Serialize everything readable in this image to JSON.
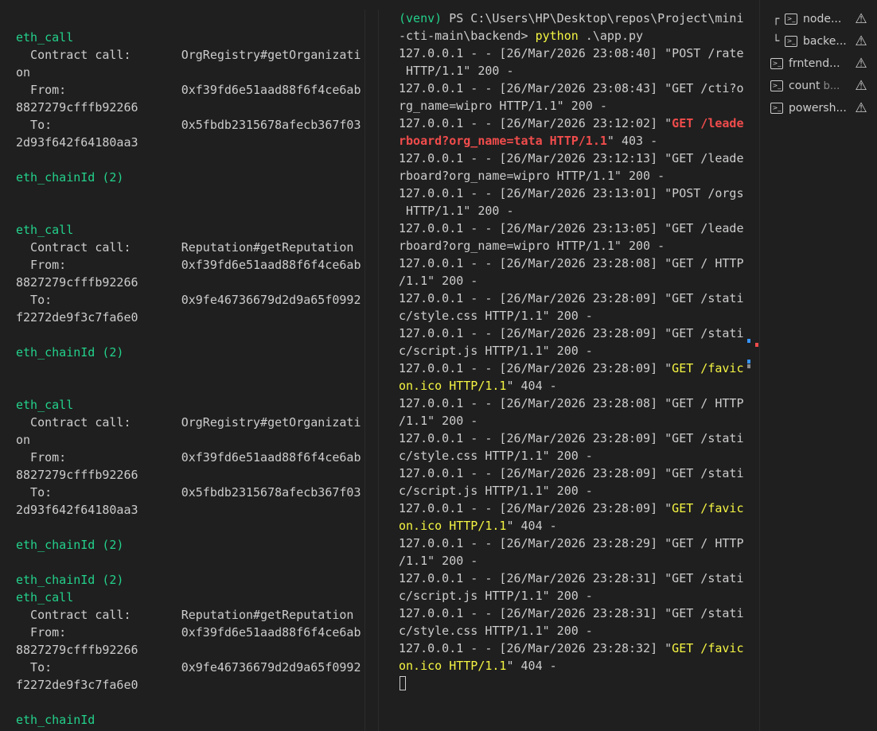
{
  "left_terminal": [
    [
      {
        "t": "eth_call",
        "c": "green"
      }
    ],
    [
      {
        "t": "  Contract call:       OrgRegistry#getOrganizati"
      }
    ],
    [
      {
        "t": "on"
      }
    ],
    [
      {
        "t": "  From:                0xf39fd6e51aad88f6f4ce6ab"
      }
    ],
    [
      {
        "t": "8827279cfffb92266"
      }
    ],
    [
      {
        "t": "  To:                  0x5fbdb2315678afecb367f03"
      }
    ],
    [
      {
        "t": "2d93f642f64180aa3"
      }
    ],
    [
      {
        "t": ""
      }
    ],
    [
      {
        "t": "eth_chainId (2)",
        "c": "green"
      }
    ],
    [
      {
        "t": ""
      }
    ],
    [
      {
        "t": ""
      }
    ],
    [
      {
        "t": "eth_call",
        "c": "green"
      }
    ],
    [
      {
        "t": "  Contract call:       Reputation#getReputation"
      }
    ],
    [
      {
        "t": "  From:                0xf39fd6e51aad88f6f4ce6ab"
      }
    ],
    [
      {
        "t": "8827279cfffb92266"
      }
    ],
    [
      {
        "t": "  To:                  0x9fe46736679d2d9a65f0992"
      }
    ],
    [
      {
        "t": "f2272de9f3c7fa6e0"
      }
    ],
    [
      {
        "t": ""
      }
    ],
    [
      {
        "t": "eth_chainId (2)",
        "c": "green"
      }
    ],
    [
      {
        "t": ""
      }
    ],
    [
      {
        "t": ""
      }
    ],
    [
      {
        "t": "eth_call",
        "c": "green"
      }
    ],
    [
      {
        "t": "  Contract call:       OrgRegistry#getOrganizati"
      }
    ],
    [
      {
        "t": "on"
      }
    ],
    [
      {
        "t": "  From:                0xf39fd6e51aad88f6f4ce6ab"
      }
    ],
    [
      {
        "t": "8827279cfffb92266"
      }
    ],
    [
      {
        "t": "  To:                  0x5fbdb2315678afecb367f03"
      }
    ],
    [
      {
        "t": "2d93f642f64180aa3"
      }
    ],
    [
      {
        "t": ""
      }
    ],
    [
      {
        "t": "eth_chainId (2)",
        "c": "green"
      }
    ],
    [
      {
        "t": ""
      }
    ],
    [
      {
        "t": "eth_chainId (2)",
        "c": "green"
      }
    ],
    [
      {
        "t": "eth_call",
        "c": "green"
      }
    ],
    [
      {
        "t": "  Contract call:       Reputation#getReputation"
      }
    ],
    [
      {
        "t": "  From:                0xf39fd6e51aad88f6f4ce6ab"
      }
    ],
    [
      {
        "t": "8827279cfffb92266"
      }
    ],
    [
      {
        "t": "  To:                  0x9fe46736679d2d9a65f0992"
      }
    ],
    [
      {
        "t": "f2272de9f3c7fa6e0"
      }
    ],
    [
      {
        "t": ""
      }
    ],
    [
      {
        "t": "eth_chainId",
        "c": "green"
      }
    ]
  ],
  "right_terminal": [
    [
      {
        "t": "(venv)",
        "c": "green"
      },
      {
        "t": " PS C:\\Users\\HP\\Desktop\\repos\\Project\\mini"
      }
    ],
    [
      {
        "t": "-cti-main\\backend> "
      },
      {
        "t": "python",
        "c": "yellow"
      },
      {
        "t": " .\\app.py"
      }
    ],
    [
      {
        "t": "127.0.0.1 - - [26/Mar/2026 23:08:40] \"POST /rate"
      }
    ],
    [
      {
        "t": " HTTP/1.1\" 200 -"
      }
    ],
    [
      {
        "t": "127.0.0.1 - - [26/Mar/2026 23:08:43] \"GET /cti?o"
      }
    ],
    [
      {
        "t": "rg_name=wipro HTTP/1.1\" 200 -"
      }
    ],
    [
      {
        "t": "127.0.0.1 - - [26/Mar/2026 23:12:02] \""
      },
      {
        "t": "GET /leade",
        "c": "red"
      }
    ],
    [
      {
        "t": "rboard?org_name=tata HTTP/1.1",
        "c": "red"
      },
      {
        "t": "\" 403 -"
      }
    ],
    [
      {
        "t": "127.0.0.1 - - [26/Mar/2026 23:12:13] \"GET /leade"
      }
    ],
    [
      {
        "t": "rboard?org_name=wipro HTTP/1.1\" 200 -"
      }
    ],
    [
      {
        "t": "127.0.0.1 - - [26/Mar/2026 23:13:01] \"POST /orgs"
      }
    ],
    [
      {
        "t": " HTTP/1.1\" 200 -"
      }
    ],
    [
      {
        "t": "127.0.0.1 - - [26/Mar/2026 23:13:05] \"GET /leade"
      }
    ],
    [
      {
        "t": "rboard?org_name=wipro HTTP/1.1\" 200 -"
      }
    ],
    [
      {
        "t": "127.0.0.1 - - [26/Mar/2026 23:28:08] \"GET / HTTP"
      }
    ],
    [
      {
        "t": "/1.1\" 200 -"
      }
    ],
    [
      {
        "t": "127.0.0.1 - - [26/Mar/2026 23:28:09] \"GET /stati"
      }
    ],
    [
      {
        "t": "c/style.css HTTP/1.1\" 200 -"
      }
    ],
    [
      {
        "t": "127.0.0.1 - - [26/Mar/2026 23:28:09] \"GET /stati"
      }
    ],
    [
      {
        "t": "c/script.js HTTP/1.1\" 200 -"
      }
    ],
    [
      {
        "t": "127.0.0.1 - - [26/Mar/2026 23:28:09] \""
      },
      {
        "t": "GET /favic",
        "c": "yellow"
      }
    ],
    [
      {
        "t": "on.ico HTTP/1.1",
        "c": "yellow"
      },
      {
        "t": "\" 404 -"
      }
    ],
    [
      {
        "t": "127.0.0.1 - - [26/Mar/2026 23:28:08] \"GET / HTTP"
      }
    ],
    [
      {
        "t": "/1.1\" 200 -"
      }
    ],
    [
      {
        "t": "127.0.0.1 - - [26/Mar/2026 23:28:09] \"GET /stati"
      }
    ],
    [
      {
        "t": "c/style.css HTTP/1.1\" 200 -"
      }
    ],
    [
      {
        "t": "127.0.0.1 - - [26/Mar/2026 23:28:09] \"GET /stati"
      }
    ],
    [
      {
        "t": "c/script.js HTTP/1.1\" 200 -"
      }
    ],
    [
      {
        "t": "127.0.0.1 - - [26/Mar/2026 23:28:09] \""
      },
      {
        "t": "GET /favic",
        "c": "yellow"
      }
    ],
    [
      {
        "t": "on.ico HTTP/1.1",
        "c": "yellow"
      },
      {
        "t": "\" 404 -"
      }
    ],
    [
      {
        "t": "127.0.0.1 - - [26/Mar/2026 23:28:29] \"GET / HTTP"
      }
    ],
    [
      {
        "t": "/1.1\" 200 -"
      }
    ],
    [
      {
        "t": "127.0.0.1 - - [26/Mar/2026 23:28:31] \"GET /stati"
      }
    ],
    [
      {
        "t": "c/script.js HTTP/1.1\" 200 -"
      }
    ],
    [
      {
        "t": "127.0.0.1 - - [26/Mar/2026 23:28:31] \"GET /stati"
      }
    ],
    [
      {
        "t": "c/style.css HTTP/1.1\" 200 -"
      }
    ],
    [
      {
        "t": "127.0.0.1 - - [26/Mar/2026 23:28:32] \""
      },
      {
        "t": "GET /favic",
        "c": "yellow"
      }
    ],
    [
      {
        "t": "on.ico HTTP/1.1",
        "c": "yellow"
      },
      {
        "t": "\" 404 -"
      }
    ]
  ],
  "terminal_list": [
    {
      "label": "node...",
      "sub": "",
      "tree": "top",
      "icon": "terminal-icon",
      "warning": true
    },
    {
      "label": "backe...",
      "sub": "",
      "tree": "bottom",
      "icon": "terminal-icon",
      "warning": true
    },
    {
      "label": "frntend...",
      "sub": "",
      "tree": "",
      "icon": "terminal-icon",
      "warning": true
    },
    {
      "label": "count",
      "sub": "b...",
      "tree": "",
      "icon": "terminal-icon",
      "warning": true
    },
    {
      "label": "powersh...",
      "sub": "",
      "tree": "",
      "icon": "terminal-icon",
      "warning": true
    }
  ],
  "colors": {
    "background": "#1f1f1f",
    "text": "#cccccc",
    "green": "#23d18b",
    "yellow": "#f5f543",
    "red": "#f14c4c",
    "accent": "#0078d4"
  }
}
